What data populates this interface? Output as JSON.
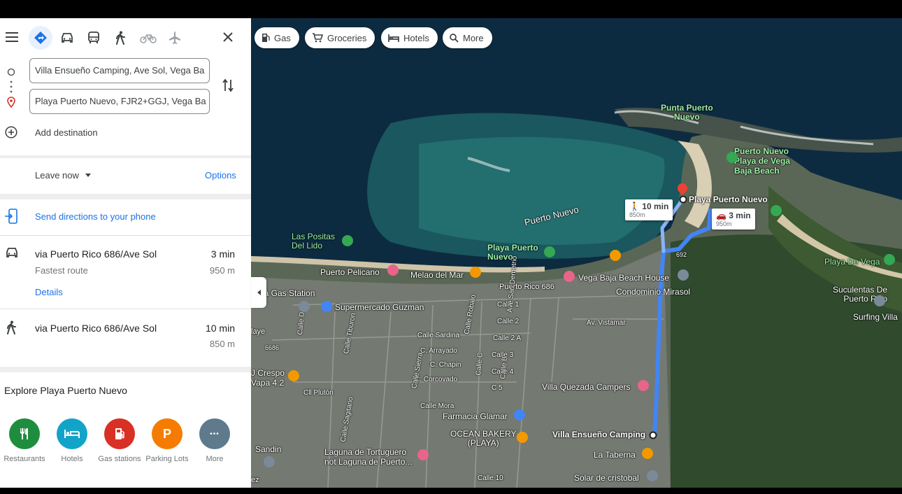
{
  "travel_modes": [
    "best-route",
    "driving",
    "transit",
    "walking",
    "cycling",
    "flights"
  ],
  "origin": {
    "value": "Villa Ensueño Camping, Ave Sol, Vega Ba"
  },
  "destination": {
    "value": "Playa Puerto Nuevo, FJR2+GGJ, Vega Ba"
  },
  "add_destination": "Add destination",
  "leave_now": "Leave now",
  "options": "Options",
  "send_directions": "Send directions to your phone",
  "routes": [
    {
      "mode": "driving",
      "via": "via Puerto Rico 686/Ave Sol",
      "note": "Fastest route",
      "time": "3 min",
      "distance": "950 m",
      "details": "Details"
    },
    {
      "mode": "walking",
      "via": "via Puerto Rico 686/Ave Sol",
      "time": "10 min",
      "distance": "850 m"
    }
  ],
  "explore_title": "Explore Playa Puerto Nuevo",
  "categories": [
    {
      "label": "Restaurants",
      "color": "#1e8e3e",
      "icon": "fork-knife-icon"
    },
    {
      "label": "Hotels",
      "color": "#12a4c8",
      "icon": "bed-icon"
    },
    {
      "label": "Gas stations",
      "color": "#d93025",
      "icon": "gas-pump-icon"
    },
    {
      "label": "Parking Lots",
      "color": "#f57c00",
      "icon": "parking-icon",
      "glyph": "P"
    },
    {
      "label": "More",
      "color": "#5f7a8c",
      "icon": "more-dots-icon",
      "glyph": "•••"
    }
  ],
  "chips": [
    {
      "label": "Gas",
      "icon": "gas-icon"
    },
    {
      "label": "Groceries",
      "icon": "cart-icon"
    },
    {
      "label": "Hotels",
      "icon": "bed-icon"
    },
    {
      "label": "More",
      "icon": "search-icon"
    }
  ],
  "map": {
    "callouts": {
      "walk": {
        "time": "10 min",
        "distance": "850m"
      },
      "drive": {
        "time": "3 min",
        "distance": "950m"
      }
    },
    "labels": {
      "punta": "Punta Puerto\nNuevo",
      "pn_beach": "Puerto Nuevo\nPlaya de Vega\nBaja Beach",
      "playa_pn": "Playa Puerto Nuevo",
      "puerto_nuevo": "Puerto Nuevo",
      "positas": "Las Positas\nDel Lido",
      "playa_pn_green": "Playa Puerto\nNuevo",
      "playa_de_vega": "Playa De Vega",
      "suculentas": "Suculentas De\nPuerto Rico",
      "surfing": "Surfing Villa",
      "pelicano": "Puerto Pelicano",
      "melao": "Melao del Mar",
      "pr686": "Puerto Rico 686",
      "vbbh": "Vega Baja Beach House",
      "mirasol": "Condominio Mirasol",
      "gas_station": "uma Gas Station",
      "super": "Supermercado Guzman",
      "vistamar": "Av. Vistamar",
      "crespo": "J Crespo\nVapa 4.2",
      "pluton": "Cll Plutón",
      "quezada": "Villa Quezada Campers",
      "farmacia": "Farmacia Glamar",
      "ocean": "OCEAN BAKERY\n(PLAYA)",
      "villa_ensueno": "Villa Ensueño Camping",
      "laguna": "Laguna de Tortuguero\nnot Laguna de Puerto...",
      "taberna": "La Taberna",
      "solar": "Solar de cristobal",
      "sandin": "Sandin",
      "cll_sardina": "Calle Sardina",
      "c_arrayado": "C. Arrayado",
      "c_chapin": "C. Chapin",
      "c_corcovado": "C. Corcovado",
      "calle_mora": "Calle Mora",
      "calle_sierra": "Calle Sierra",
      "calle_robalo": "Calle Robalo",
      "calle_tiburon": "Calle Tiburon",
      "calle_sagitario": "Calle Sagitario",
      "calle_1": "Calle 1",
      "calle_2": "Calle 2",
      "calle_2a": "Calle 2 A",
      "calle_3": "Calle 3",
      "calle_4": "Calle 4",
      "calle_5": "C 5",
      "calle_10": "Calle 10",
      "ave_demetrio": "Ave San Demetrio",
      "yaye": "laye",
      "rd6686": "6686",
      "route692": "692",
      "calle_d": "Calle D",
      "calle_c": "Calle C",
      "calle_b": "Calle B",
      "ez": "ez"
    }
  }
}
